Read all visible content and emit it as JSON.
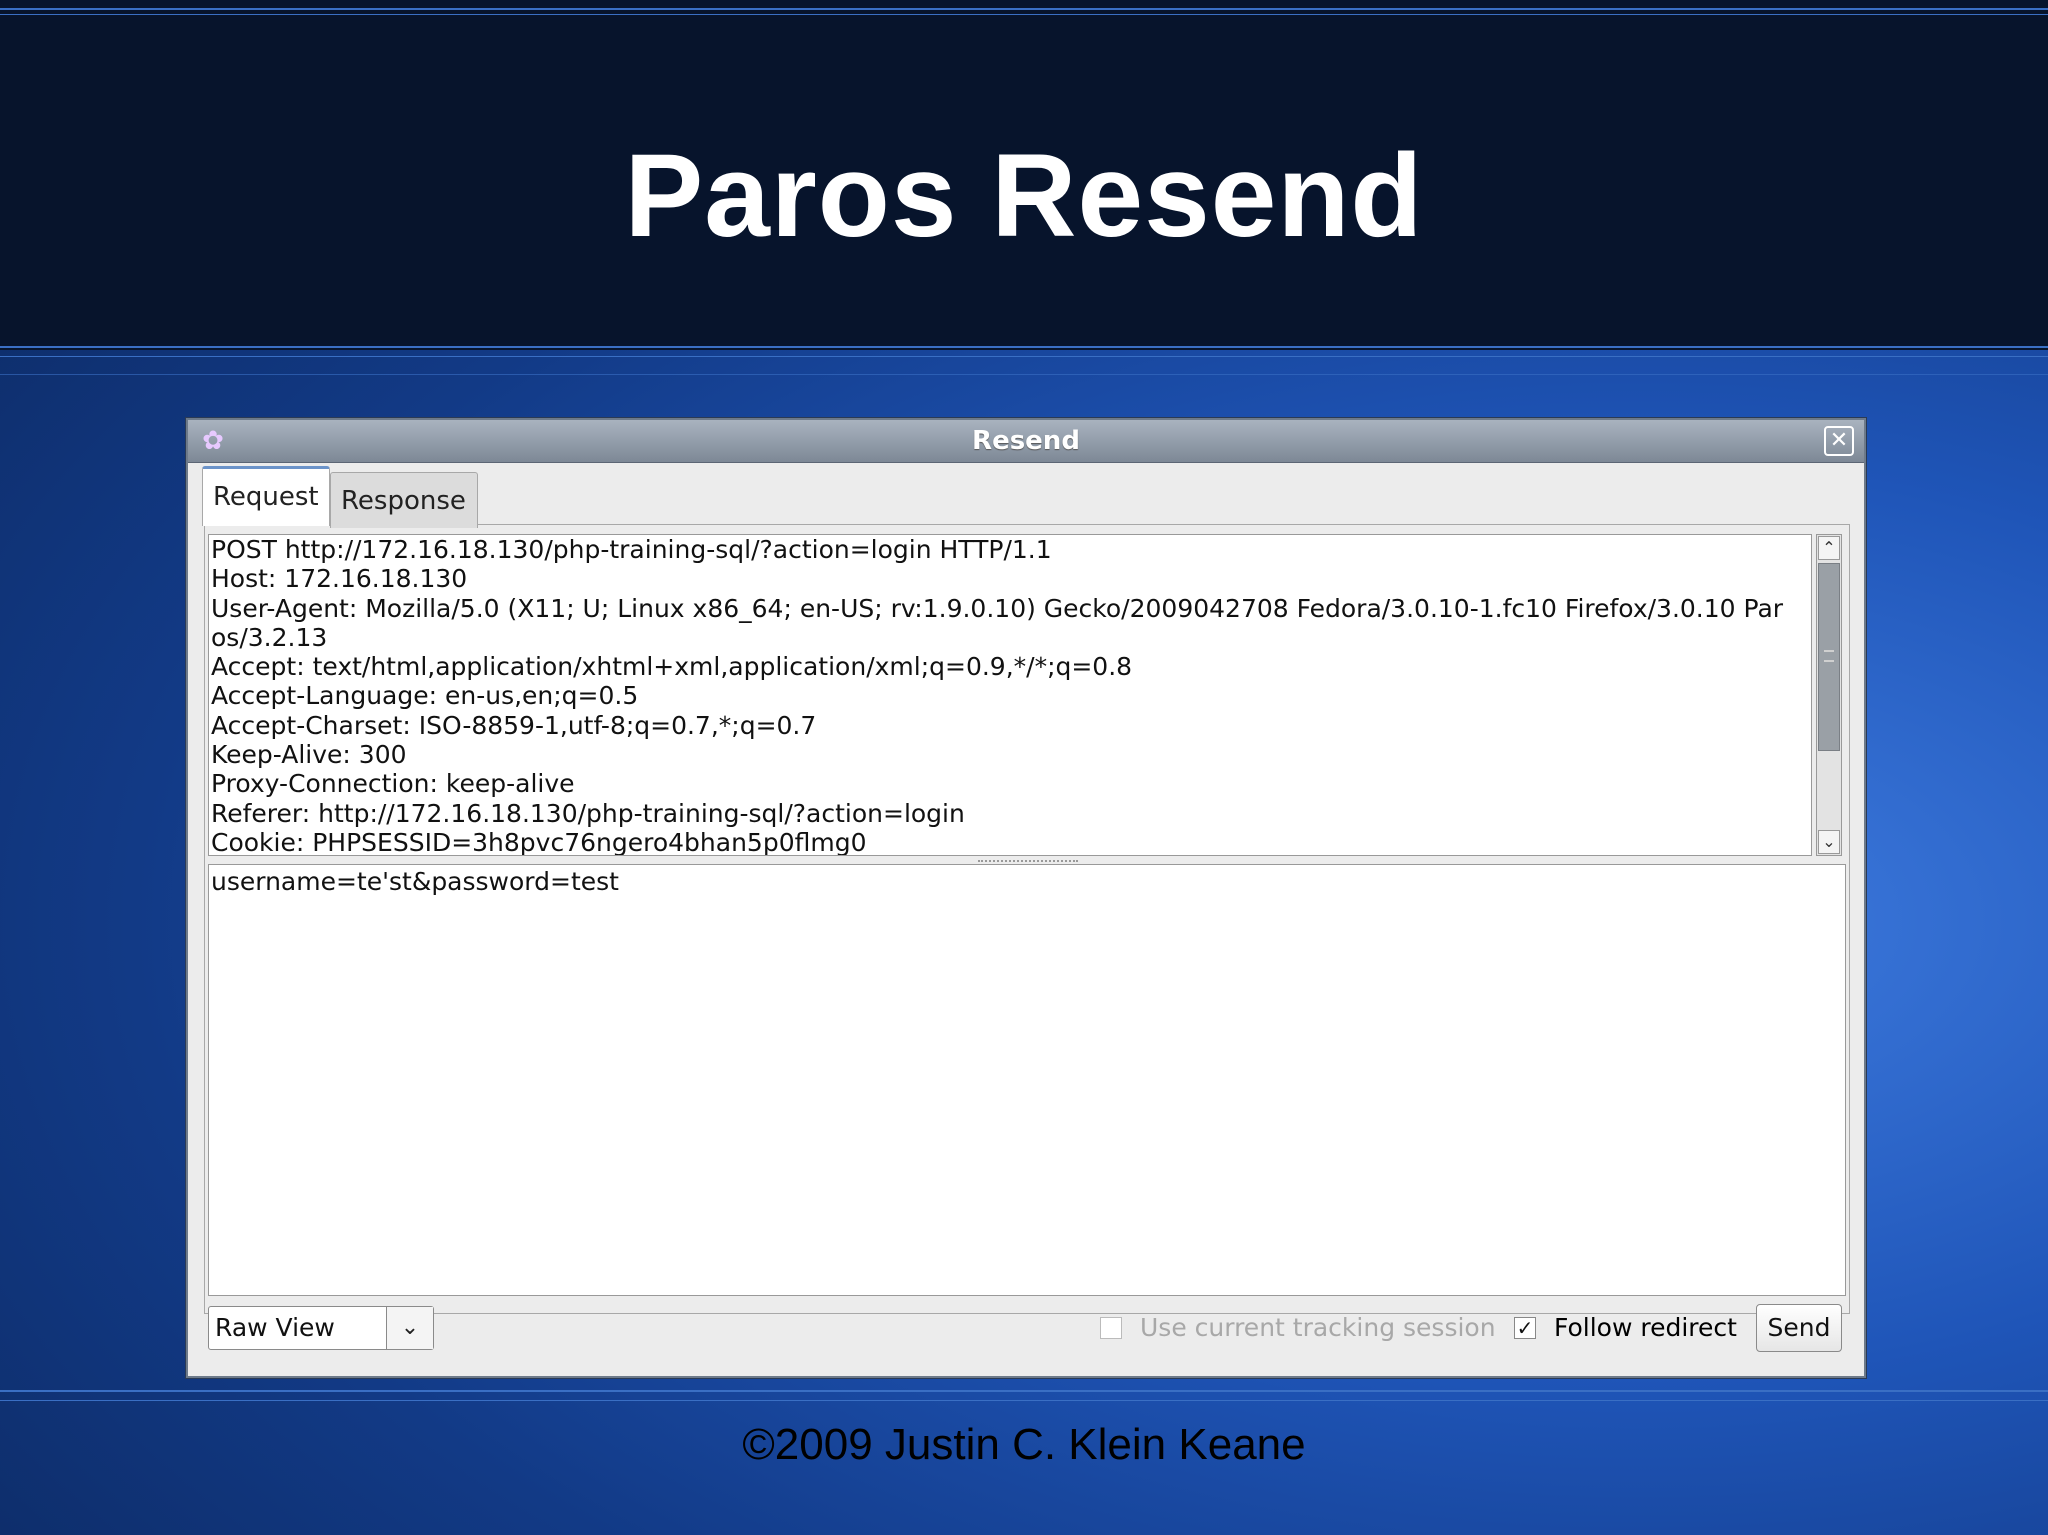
{
  "slide": {
    "title": "Paros Resend",
    "footer": "©2009 Justin C. Klein Keane"
  },
  "dialog": {
    "title": "Resend",
    "close_glyph": "✕",
    "tabs": [
      {
        "label": "Request",
        "active": true
      },
      {
        "label": "Response",
        "active": false
      }
    ],
    "request_headers": [
      "POST http://172.16.18.130/php-training-sql/?action=login HTTP/1.1",
      "Host: 172.16.18.130",
      "User-Agent: Mozilla/5.0 (X11; U; Linux x86_64; en-US; rv:1.9.0.10) Gecko/2009042708 Fedora/3.0.10-1.fc10 Firefox/3.0.10 Par",
      "os/3.2.13",
      "Accept: text/html,application/xhtml+xml,application/xml;q=0.9,*/*;q=0.8",
      "Accept-Language: en-us,en;q=0.5",
      "Accept-Charset: ISO-8859-1,utf-8;q=0.7,*;q=0.7",
      "Keep-Alive: 300",
      "Proxy-Connection: keep-alive",
      "Referer: http://172.16.18.130/php-training-sql/?action=login",
      "Cookie: PHPSESSID=3h8pvc76ngero4bhan5p0flmg0"
    ],
    "request_body": "username=te'st&password=test",
    "view_select": {
      "value": "Raw View"
    },
    "use_tracking_session": {
      "label": "Use current tracking session",
      "checked": false,
      "enabled": false
    },
    "follow_redirect": {
      "label": "Follow redirect",
      "checked": true,
      "enabled": true
    },
    "send_label": "Send"
  },
  "icons": {
    "app": "paros-app-icon",
    "close": "close-icon",
    "dropdown": "chevron-down-icon",
    "scroll_up": "chevron-up-icon",
    "scroll_down": "chevron-down-icon"
  },
  "colors": {
    "header_band": "#07142c",
    "background_blue": "#1f55b8",
    "titlebar": "#8e99a7",
    "title_text": "#ffffff"
  }
}
